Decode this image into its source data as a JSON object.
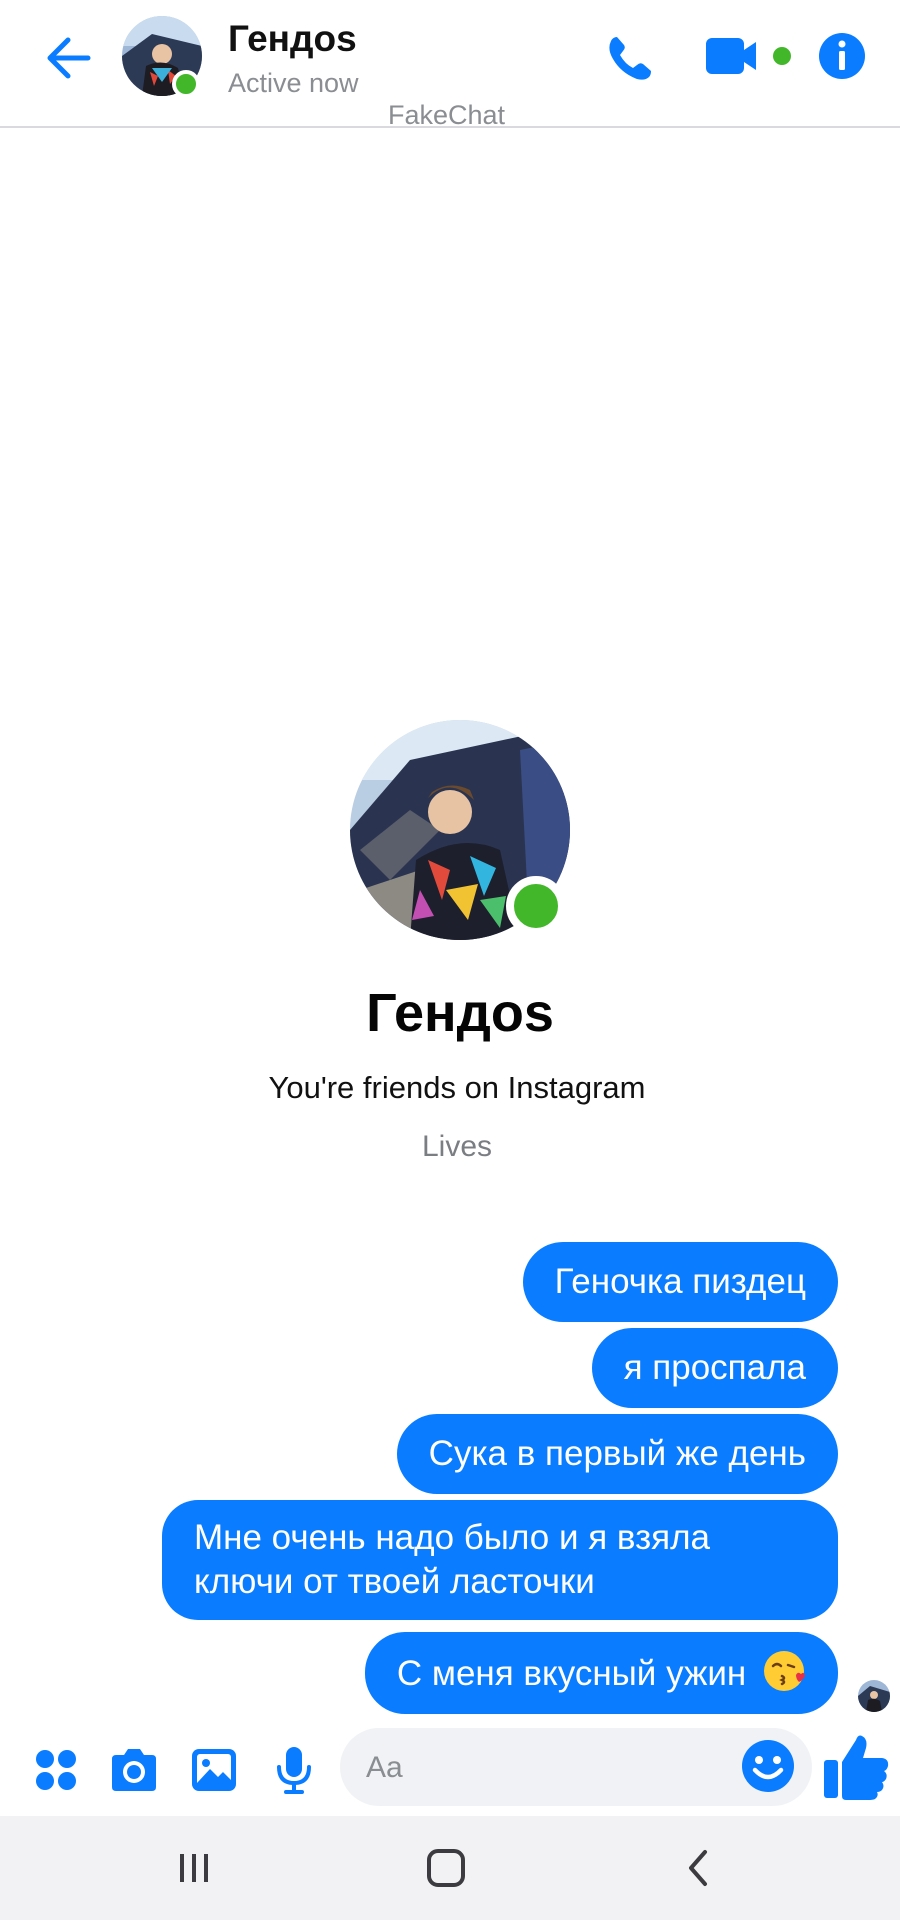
{
  "header": {
    "contact_name": "Гендоs",
    "status": "Active now",
    "watermark": "FakeChat",
    "icons": [
      "back-arrow-icon",
      "phone-icon",
      "video-camera-icon",
      "info-icon"
    ]
  },
  "profile": {
    "name": "Гендоs",
    "subtitle": "You're friends on Instagram",
    "location": "Lives"
  },
  "messages": [
    {
      "text": "Геночка пиздец",
      "direction": "outgoing"
    },
    {
      "text": "я проспала",
      "direction": "outgoing"
    },
    {
      "text": "Сука в первый же день",
      "direction": "outgoing"
    },
    {
      "text": "Мне очень надо было и я взяла ключи от твоей ласточки",
      "direction": "outgoing"
    },
    {
      "text": "С меня вкусный ужин",
      "direction": "outgoing",
      "emoji": "kissing-face-icon"
    }
  ],
  "composer": {
    "placeholder": "Aa",
    "icons": [
      "apps-icon",
      "camera-icon",
      "gallery-icon",
      "microphone-icon",
      "smiley-icon",
      "thumbs-up-icon"
    ]
  },
  "navbar": {
    "icons": [
      "recent-apps-icon",
      "home-icon",
      "back-icon"
    ]
  },
  "colors": {
    "accent": "#0a7cff",
    "online": "#42b72a",
    "secondary_text": "#8a8d91"
  }
}
